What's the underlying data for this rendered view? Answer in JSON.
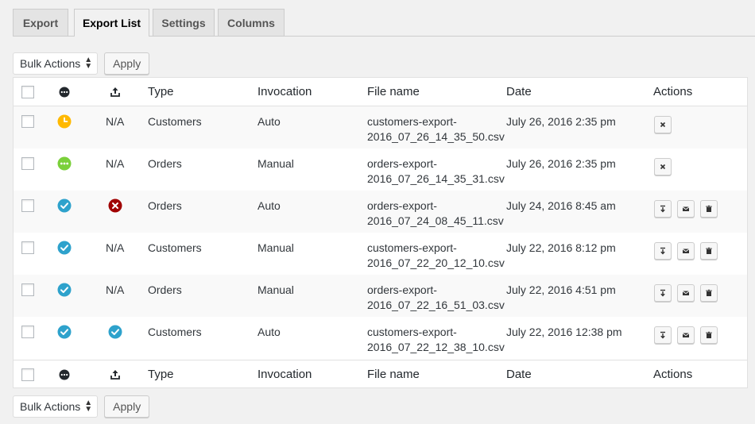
{
  "tabs": [
    {
      "label": "Export"
    },
    {
      "label": "Export List"
    },
    {
      "label": "Settings"
    },
    {
      "label": "Columns"
    }
  ],
  "bulk": {
    "select_label": "Bulk Actions",
    "apply_label": "Apply"
  },
  "columns": {
    "type": "Type",
    "invocation": "Invocation",
    "file_name": "File name",
    "date": "Date",
    "actions": "Actions"
  },
  "colors": {
    "queued": "#ffb900",
    "processing": "#7ad03a",
    "done": "#2ea2cc",
    "failed": "#a00000"
  },
  "rows": [
    {
      "status": "queued-clock-icon",
      "transfer": "N/A",
      "type": "Customers",
      "invocation": "Auto",
      "file_name_1": "customers-export-",
      "file_name_2": "2016_07_26_14_35_50.csv",
      "date": "July 26, 2016 2:35 pm",
      "actions": [
        "cancel-icon"
      ]
    },
    {
      "status": "processing-ellipsis-icon",
      "transfer": "N/A",
      "type": "Orders",
      "invocation": "Manual",
      "file_name_1": "orders-export-",
      "file_name_2": "2016_07_26_14_35_31.csv",
      "date": "July 26, 2016 2:35 pm",
      "actions": [
        "cancel-icon"
      ]
    },
    {
      "status": "completed-check-icon",
      "transfer": "failed-x-icon",
      "type": "Orders",
      "invocation": "Auto",
      "file_name_1": "orders-export-",
      "file_name_2": "2016_07_24_08_45_11.csv",
      "date": "July 24, 2016 8:45 am",
      "actions": [
        "download-icon",
        "email-icon",
        "trash-icon"
      ]
    },
    {
      "status": "completed-check-icon",
      "transfer": "N/A",
      "type": "Customers",
      "invocation": "Manual",
      "file_name_1": "customers-export-",
      "file_name_2": "2016_07_22_20_12_10.csv",
      "date": "July 22, 2016 8:12 pm",
      "actions": [
        "download-icon",
        "email-icon",
        "trash-icon"
      ]
    },
    {
      "status": "completed-check-icon",
      "transfer": "N/A",
      "type": "Orders",
      "invocation": "Manual",
      "file_name_1": "orders-export-",
      "file_name_2": "2016_07_22_16_51_03.csv",
      "date": "July 22, 2016 4:51 pm",
      "actions": [
        "download-icon",
        "email-icon",
        "trash-icon"
      ]
    },
    {
      "status": "completed-check-icon",
      "transfer": "transferred-check-icon",
      "type": "Customers",
      "invocation": "Auto",
      "file_name_1": "customers-export-",
      "file_name_2": "2016_07_22_12_38_10.csv",
      "date": "July 22, 2016 12:38 pm",
      "actions": [
        "download-icon",
        "email-icon",
        "trash-icon"
      ]
    }
  ]
}
